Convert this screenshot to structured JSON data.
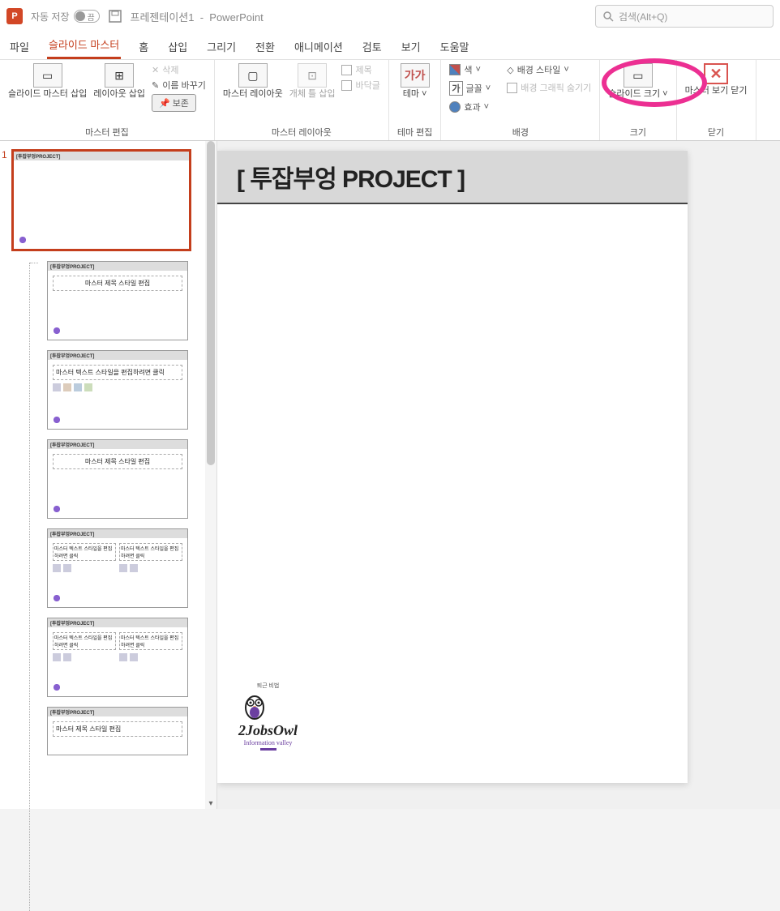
{
  "app": {
    "autosave_label": "자동 저장",
    "autosave_state": "끔",
    "doc_name": "프레젠테이션1",
    "app_name": "PowerPoint",
    "search_placeholder": "검색(Alt+Q)"
  },
  "menu": {
    "items": [
      "파일",
      "슬라이드 마스터",
      "홈",
      "삽입",
      "그리기",
      "전환",
      "애니메이션",
      "검토",
      "보기",
      "도움말"
    ],
    "active_index": 1
  },
  "ribbon": {
    "group1": {
      "label": "마스터 편집",
      "insert_master": "슬라이드 마스터 삽입",
      "insert_layout": "레이아웃 삽입",
      "delete": "삭제",
      "rename": "이름 바꾸기",
      "preserve": "보존"
    },
    "group2": {
      "label": "마스터 레이아웃",
      "master_layout": "마스터 레이아웃",
      "placeholder_insert": "개체 틀 삽입",
      "title_chk": "제목",
      "footers_chk": "바닥글"
    },
    "group3": {
      "label": "테마 편집",
      "theme": "테마"
    },
    "group4": {
      "label": "배경",
      "colors": "색",
      "fonts": "글꼴",
      "effects": "효과",
      "bg_styles": "배경 스타일",
      "hide_bg": "배경 그래픽 숨기기"
    },
    "group5": {
      "label": "크기",
      "slide_size": "슬라이드 크기"
    },
    "group6": {
      "label": "닫기",
      "close_master": "마스터 보기 닫기"
    }
  },
  "thumbs": {
    "index": "1",
    "project_tag": "[투잡부엉PROJECT]",
    "layout_title": "마스터 제목 스타일 편집",
    "layout_text": "마스터 텍스트 스타일을 편집하려면 클릭"
  },
  "slide": {
    "title": "[ 투잡부엉 PROJECT ]",
    "logo_text": "2JobsOwl",
    "logo_sub": "Information valley",
    "logo_top": "퇴근 비법"
  }
}
